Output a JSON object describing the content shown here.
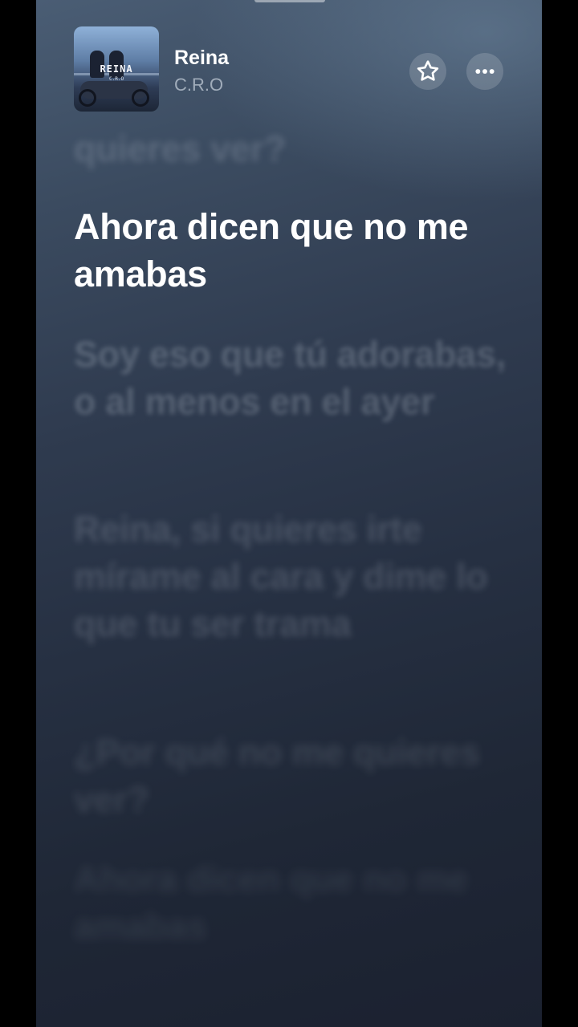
{
  "now_playing": {
    "title": "Reina",
    "artist": "C.R.O",
    "artwork": {
      "title_text": "REINA",
      "subtitle_text": "C.R.O"
    }
  },
  "actions": {
    "favorite_icon": "star-outline-icon",
    "more_icon": "ellipsis-icon"
  },
  "lyrics": {
    "previous": "quieres ver?",
    "current": "Ahora dicen que no me amabas",
    "upcoming": [
      "Soy eso que tú adorabas, o al menos en el ayer",
      "Reina, si quieres irte mírame al cara y dime lo que tu ser trama",
      "¿Por qué no me quieres ver?",
      "Ahora dicen que no me amabas"
    ]
  },
  "colors": {
    "background_top": "#4a5d74",
    "background_bottom": "#1b2130",
    "active_lyric": "#ffffff"
  }
}
